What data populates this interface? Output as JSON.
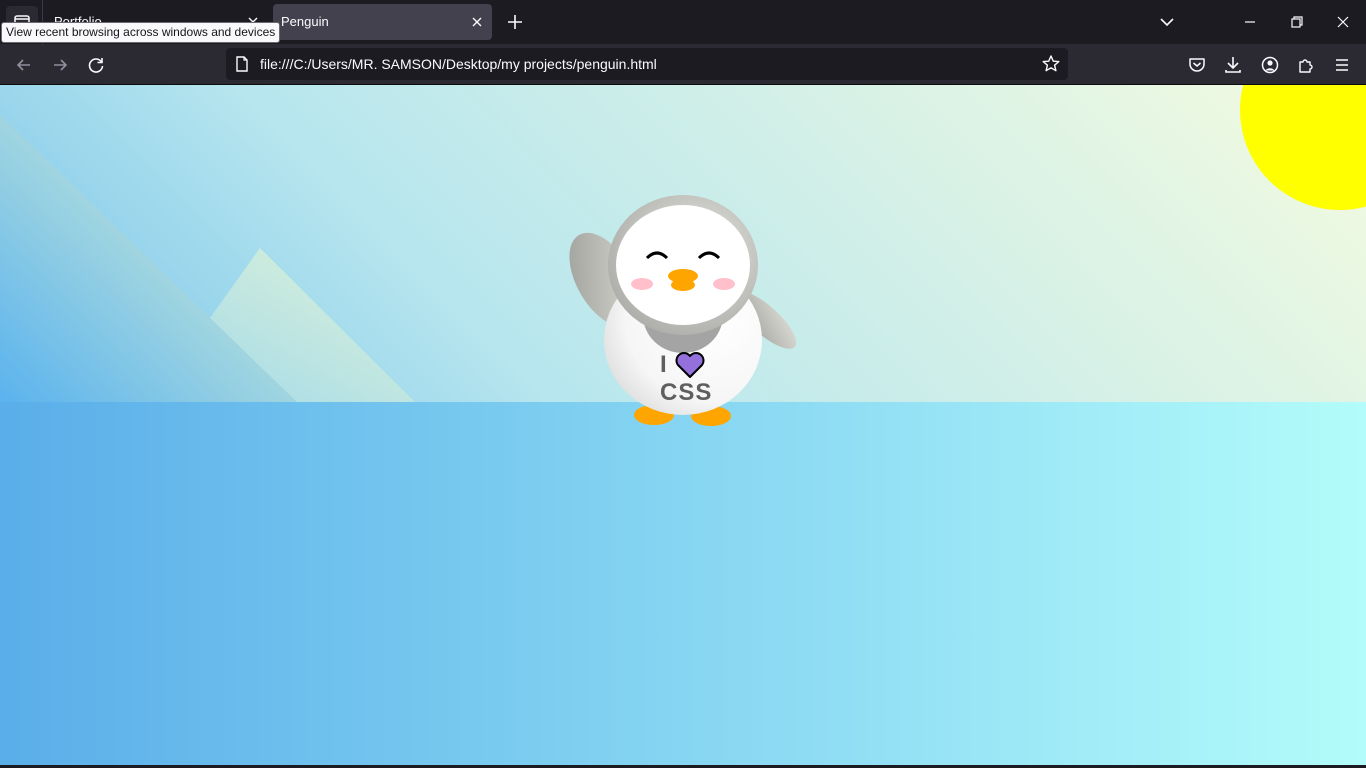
{
  "browser": {
    "tabs": [
      {
        "title": "Portfolio",
        "active": false
      },
      {
        "title": "Penguin",
        "active": true
      }
    ],
    "tooltip": "View recent browsing across windows and devices",
    "url": "file:///C:/Users/MR. SAMSON/Desktop/my projects/penguin.html",
    "icons": {
      "tab_list": "tab-list-icon",
      "new_tab": "plus-icon",
      "list_all_tabs": "chevron-down-icon",
      "back": "arrow-left-icon",
      "forward": "arrow-right-icon",
      "reload": "reload-icon",
      "bookmark": "star-icon",
      "pocket": "pocket-icon",
      "downloads": "download-icon",
      "account": "account-icon",
      "extensions": "puzzle-icon",
      "menu": "hamburger-icon"
    }
  },
  "page": {
    "shirt_line1": "I",
    "shirt_line2": "CSS",
    "colors": {
      "sun": "#ffff00",
      "heart": "#9370db",
      "beak": "#ffa500",
      "cheeks": "#ffc0cb"
    }
  }
}
